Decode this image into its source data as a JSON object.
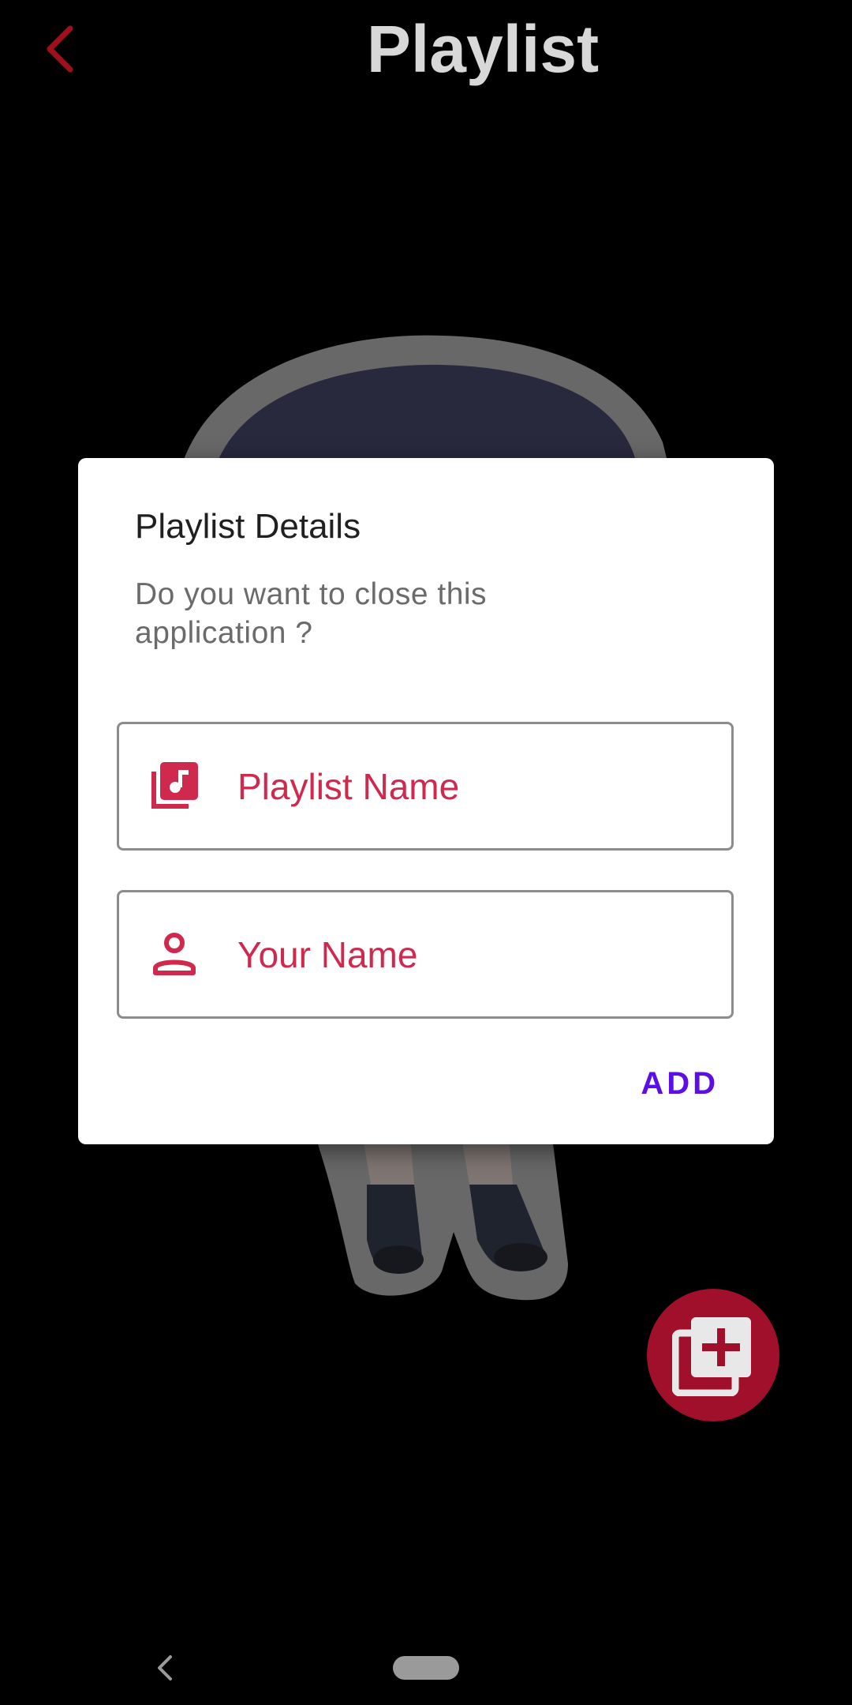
{
  "header": {
    "title": "Playlist",
    "back_icon": "chevron-left-icon",
    "back_color": "#a0101c"
  },
  "dialog": {
    "title": "Playlist Details",
    "message": "Do you want to close this application ?",
    "fields": [
      {
        "icon": "library-music-icon",
        "placeholder": "Playlist Name",
        "value": ""
      },
      {
        "icon": "person-icon",
        "placeholder": "Your Name",
        "value": ""
      }
    ],
    "add_label": "ADD",
    "accent_color": "#cf2a4e",
    "button_color": "#5b0fe6"
  },
  "fab": {
    "icon": "playlist-add-icon",
    "color": "#a0102a"
  },
  "navbar": {
    "back_icon": "nav-back-icon",
    "home_icon": "home-pill-icon"
  }
}
